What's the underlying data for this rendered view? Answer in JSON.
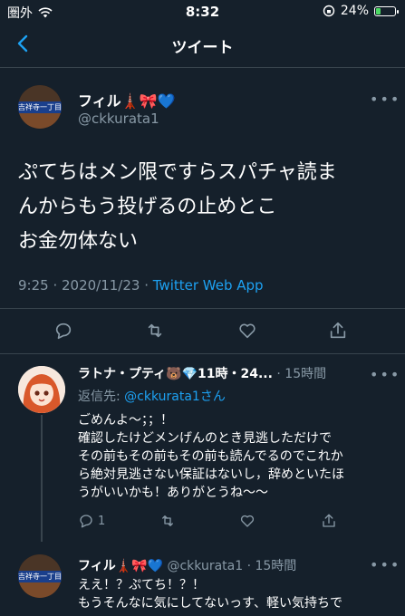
{
  "status_bar": {
    "carrier": "圏外",
    "time": "8:32",
    "battery_percent": "24%",
    "battery_level": 0.24
  },
  "nav": {
    "title": "ツイート"
  },
  "main_tweet": {
    "author": "フィル🗼🎀💙",
    "handle": "@ckkurata1",
    "avatar_sign": "吉祥寺一丁目商店街",
    "text_lines": [
      "ぷてちはメン限ですらスパチャ読ま",
      "んからもう投げるの止めとこ",
      "お金勿体ない"
    ],
    "timestamp": "9:25 · 2020/11/23 · ",
    "app": "Twitter Web App"
  },
  "reply1": {
    "author": "ラトナ・プティ🐻💎11時・24...",
    "time": "· 15時間",
    "reply_label": "返信先: ",
    "reply_mention": "@ckkurata1さん",
    "text_lines": [
      "ごめんよ～；；！",
      "確認したけどメンげんのとき見逃しただけで",
      "その前もその前もその前も読んでるのでこれか",
      "ら絶対見逃さない保証はないし，辞めといたほ",
      "うがいいかも！ありがとうね～～"
    ],
    "reply_count": "1"
  },
  "reply2": {
    "author": "フィル🗼🎀💙",
    "meta": "@ckkurata1 · 15時間",
    "text_lines": [
      "ええ！？ぷてち！？！",
      "もうそんなに気にしてないっす、軽い気持ちで"
    ]
  }
}
